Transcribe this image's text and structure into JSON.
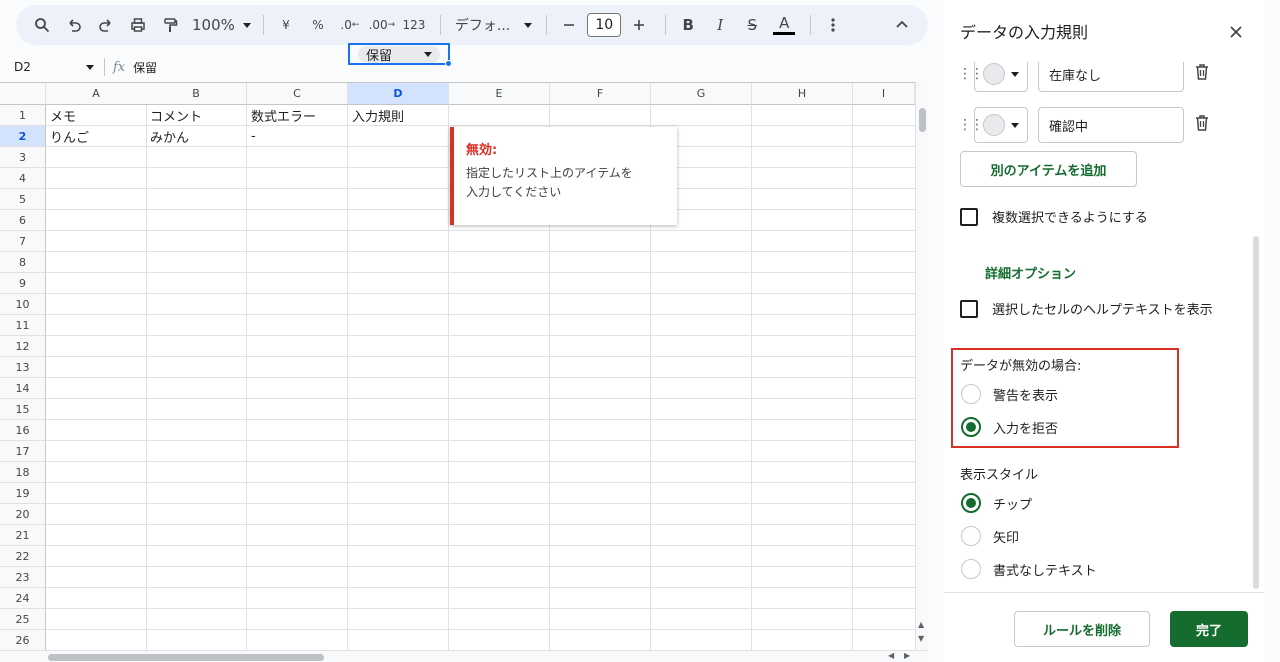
{
  "toolbar": {
    "zoom": "100%",
    "currency": "¥",
    "percent": "%",
    "dec_decrease": ".0",
    "dec_increase": ".00",
    "format_more": "123",
    "font": "デフォ...",
    "font_size": "10",
    "bold": "B",
    "italic": "I",
    "strike": "S",
    "text_color": "A"
  },
  "formula_bar": {
    "cell_ref": "D2",
    "value": "保留"
  },
  "columns": [
    "A",
    "B",
    "C",
    "D",
    "E",
    "F",
    "G",
    "H",
    "I"
  ],
  "selected_column": "D",
  "rows": [
    "1",
    "2",
    "3",
    "4",
    "5",
    "6",
    "7",
    "8",
    "9",
    "10",
    "11",
    "12",
    "13",
    "14",
    "15",
    "16",
    "17",
    "18",
    "19",
    "20",
    "21",
    "22",
    "23",
    "24",
    "25",
    "26"
  ],
  "selected_row": "2",
  "cells": {
    "A1": "メモ",
    "B1": "コメント",
    "C1": "数式エラー",
    "D1": "入力規則",
    "A2": "りんご",
    "B2": "みかん",
    "C2": "-",
    "D2": "保留"
  },
  "tooltip": {
    "title": "無効:",
    "line1": "指定したリスト上のアイテムを",
    "line2": "入力してください"
  },
  "panel": {
    "title": "データの入力規則",
    "items": [
      "在庫なし",
      "確認中"
    ],
    "add_item": "別のアイテムを追加",
    "multi_select": "複数選択できるようにする",
    "advanced_options": "詳細オプション",
    "help_text": "選択したセルのヘルプテキストを表示",
    "invalid_label": "データが無効の場合:",
    "invalid_options": [
      "警告を表示",
      "入力を拒否"
    ],
    "invalid_selected": "入力を拒否",
    "style_label": "表示スタイル",
    "style_options": [
      "チップ",
      "矢印",
      "書式なしテキスト"
    ],
    "style_selected": "チップ",
    "delete_rule": "ルールを削除",
    "done": "完了"
  },
  "colors": {
    "accent": "#146c2e",
    "error": "#d93025",
    "selection": "#1a73e8"
  }
}
